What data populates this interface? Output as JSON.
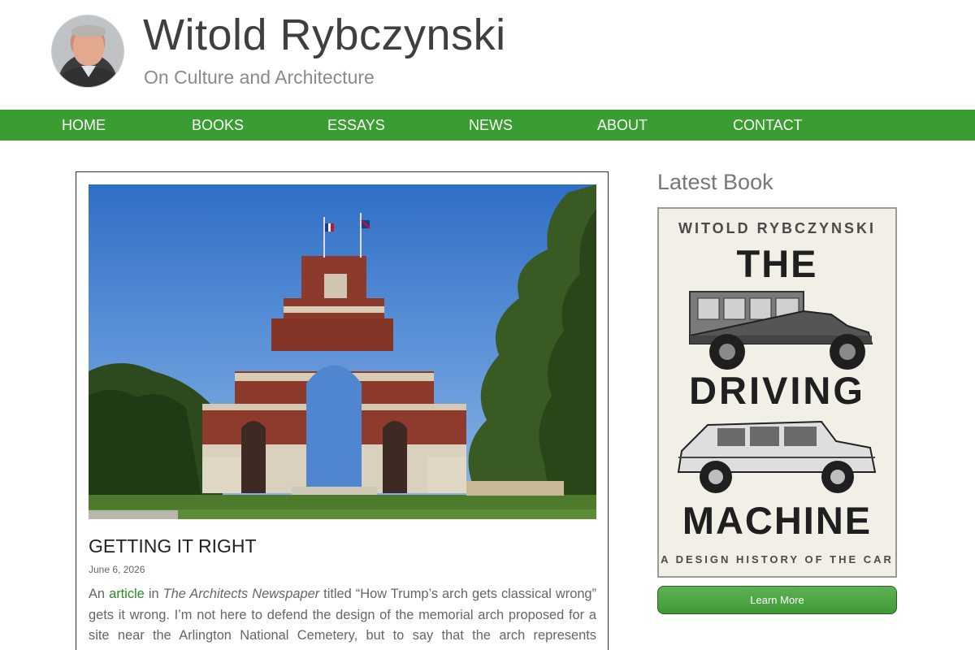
{
  "site": {
    "title": "Witold Rybczynski",
    "tagline": "On Culture and Architecture"
  },
  "nav": {
    "items": [
      {
        "label": "HOME"
      },
      {
        "label": "BOOKS"
      },
      {
        "label": "ESSAYS"
      },
      {
        "label": "NEWS"
      },
      {
        "label": "ABOUT"
      },
      {
        "label": "CONTACT"
      }
    ]
  },
  "post": {
    "title": "GETTING IT RIGHT",
    "date": "June 6, 2026",
    "excerpt": {
      "prefix": "An ",
      "link_text": "article",
      "mid": " in ",
      "publication": "The Architects Newspaper",
      "rest": " titled “How Trump’s arch gets classical wrong” gets it wrong. I’m not here to defend the design of the memorial arch proposed for a site near the Arlington National Cemetery, but to say that the arch represents “category"
    }
  },
  "sidebar": {
    "heading": "Latest Book",
    "book": {
      "author": "WITOLD RYBCZYNSKI",
      "title_line1": "THE",
      "title_line2": "DRIVING",
      "title_line3": "MACHINE",
      "subtitle": "A DESIGN HISTORY OF THE CAR"
    },
    "button_label": "Learn More"
  },
  "colors": {
    "nav_green": "#3a9d31",
    "link_green": "#2d8a25",
    "sky_blue": "#3f7fd0",
    "brick_red": "#8b3a2c"
  }
}
